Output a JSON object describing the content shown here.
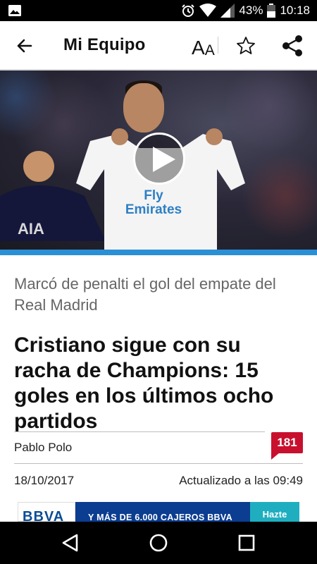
{
  "status_bar": {
    "battery_percent": "43%",
    "time": "10:18",
    "icons": [
      "image-icon",
      "alarm-icon",
      "wifi-icon",
      "signal-icon",
      "battery-icon"
    ]
  },
  "app_bar": {
    "title": "Mi Equipo",
    "font_size_label_big": "A",
    "font_size_label_small": "A",
    "icons": [
      "back-arrow-icon",
      "font-size-icon",
      "star-icon",
      "share-icon"
    ]
  },
  "hero": {
    "shirt_text": "Fly Emirates",
    "left_shirt_text": "AIA",
    "has_video": true,
    "accent_color": "#2b8fd6"
  },
  "article": {
    "subtitle": "Marcó de penalti el gol del empate del Real Madrid",
    "headline": "Cristiano sigue con su racha de Champions: 15 goles en los últimos ocho partidos",
    "author": "Pablo Polo",
    "comment_count": "181",
    "date": "18/10/2017",
    "updated": "Actualizado a las 09:49"
  },
  "ad": {
    "brand": "BBVA",
    "text": "Y MÁS DE 6.000 CAJEROS BBVA",
    "cta": "Hazte"
  },
  "nav_bar": {
    "icons": [
      "back-triangle-icon",
      "home-circle-icon",
      "recents-square-icon"
    ]
  },
  "colors": {
    "comment_badge": "#c8102e",
    "ad_blue": "#0b3d91",
    "ad_cta": "#1faec0"
  }
}
